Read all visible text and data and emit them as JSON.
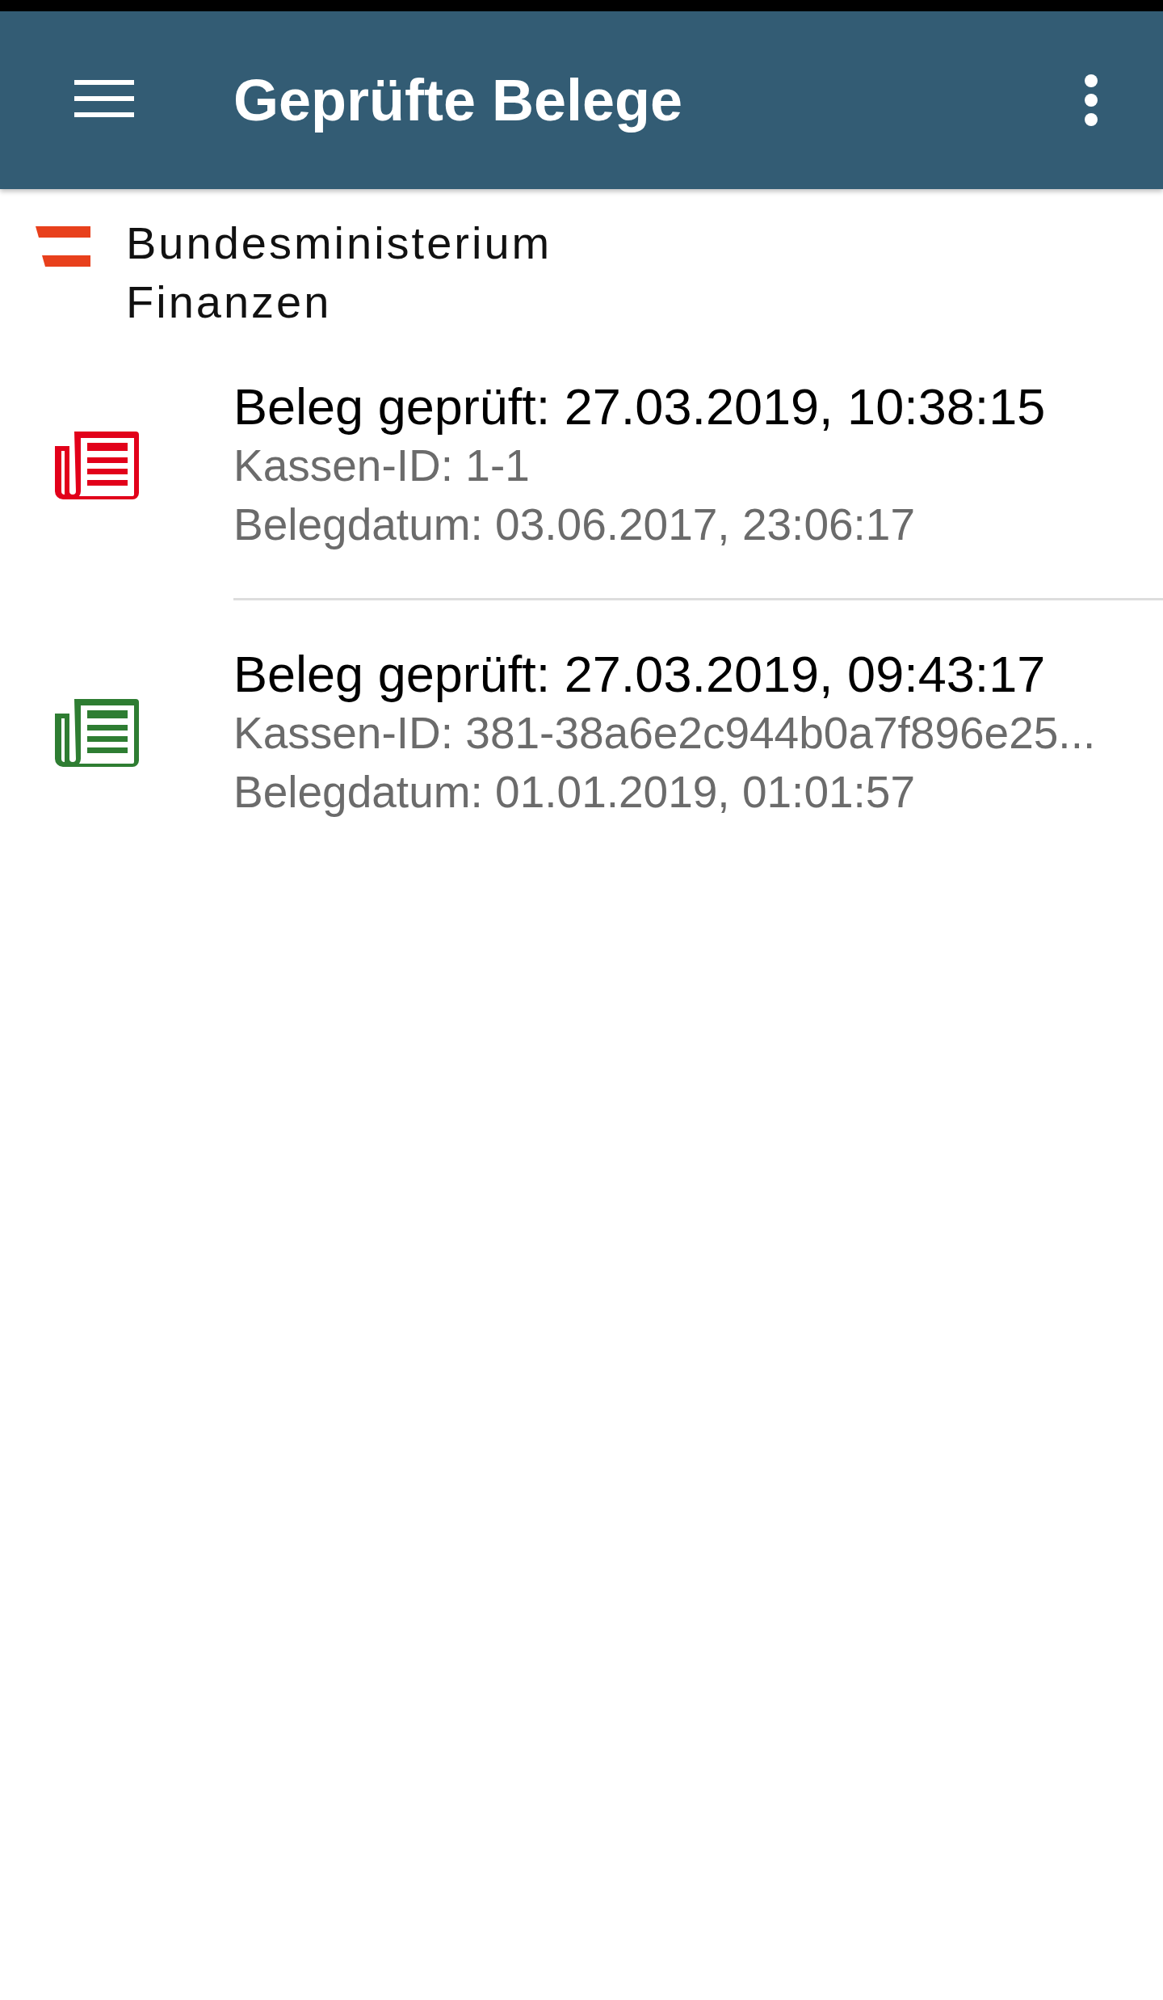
{
  "app_bar": {
    "title": "Geprüfte Belege"
  },
  "header": {
    "line_1": "Bundesministerium",
    "line_2": "Finanzen"
  },
  "receipts": [
    {
      "title": "Beleg geprüft: 27.03.2019, 10:38:15",
      "register_id": "Kassen-ID: 1-1",
      "receipt_date": "Belegdatum: 03.06.2017, 23:06:17",
      "color": "#e2001a"
    },
    {
      "title": "Beleg geprüft: 27.03.2019, 09:43:17",
      "register_id": "Kassen-ID: 381-38a6e2c944b0a7f896e25...",
      "receipt_date": "Belegdatum: 01.01.2019, 01:01:57",
      "color": "#2e7d32"
    }
  ]
}
